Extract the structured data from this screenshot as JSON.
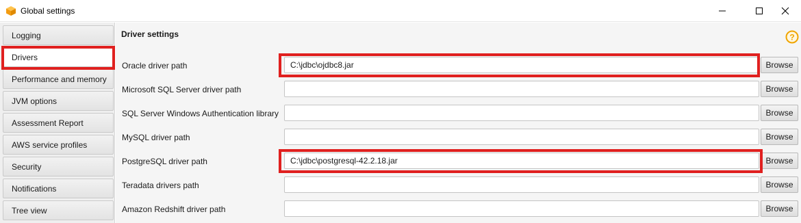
{
  "window": {
    "title": "Global settings",
    "app_icon": "aws-box-icon",
    "controls": [
      "minimize-icon",
      "maximize-icon",
      "close-icon"
    ]
  },
  "sidebar": {
    "items": [
      {
        "label": "Logging",
        "active": false
      },
      {
        "label": "Drivers",
        "active": true
      },
      {
        "label": "Performance and memory",
        "active": false
      },
      {
        "label": "JVM options",
        "active": false
      },
      {
        "label": "Assessment Report",
        "active": false
      },
      {
        "label": "AWS service profiles",
        "active": false
      },
      {
        "label": "Security",
        "active": false
      },
      {
        "label": "Notifications",
        "active": false
      },
      {
        "label": "Tree view",
        "active": false
      }
    ]
  },
  "main": {
    "section_title": "Driver settings",
    "help_icon": "question-circle-icon",
    "browse_label": "Browse",
    "rows": [
      {
        "label": "Oracle driver path",
        "value": "C:\\jdbc\\ojdbc8.jar"
      },
      {
        "label": "Microsoft SQL Server driver path",
        "value": ""
      },
      {
        "label": "SQL Server Windows Authentication library",
        "value": ""
      },
      {
        "label": "MySQL driver path",
        "value": ""
      },
      {
        "label": "PostgreSQL driver path",
        "value": "C:\\jdbc\\postgresql-42.2.18.jar"
      },
      {
        "label": "Teradata drivers path",
        "value": ""
      },
      {
        "label": "Amazon Redshift driver path",
        "value": ""
      }
    ]
  },
  "colors": {
    "highlight": "#e0201f",
    "help_icon": "#f0a500"
  }
}
